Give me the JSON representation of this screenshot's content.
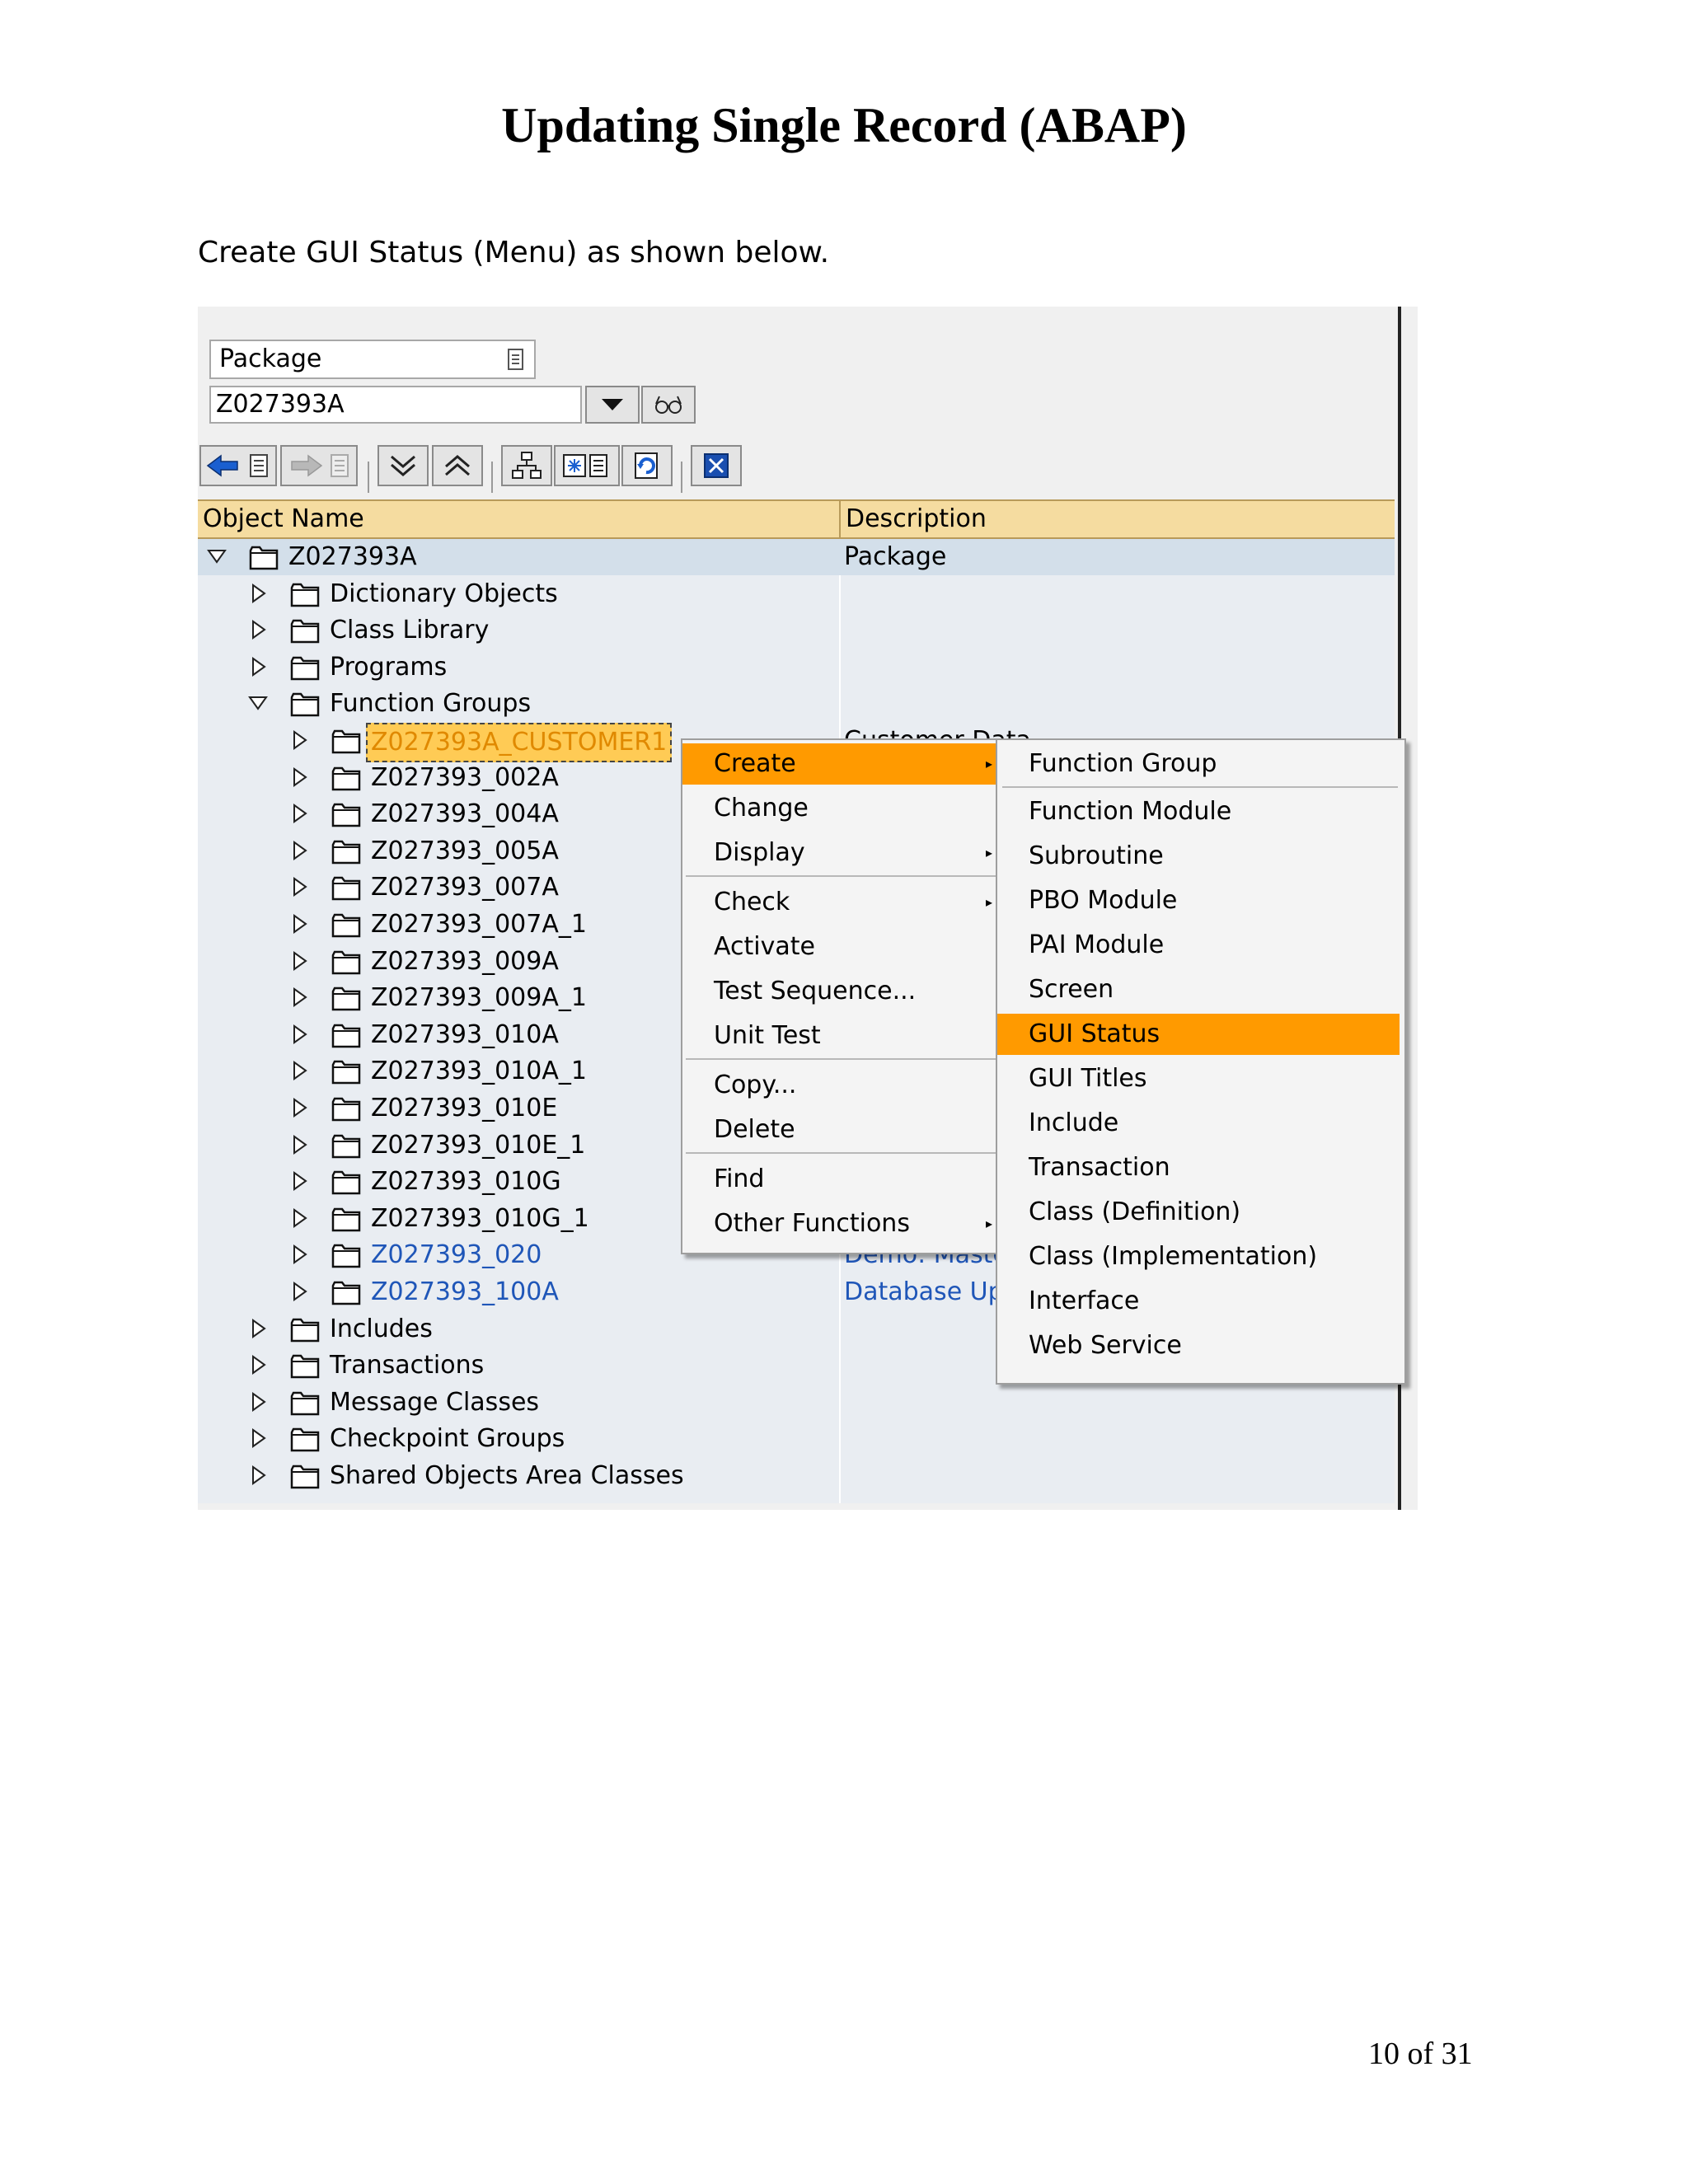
{
  "document": {
    "title": "Updating Single Record (ABAP)",
    "intro": "Create GUI Status (Menu) as shown below.",
    "page_number": "10 of 31"
  },
  "selector": {
    "type_label": "Package",
    "value": "Z027393A"
  },
  "tree": {
    "headers": {
      "name": "Object Name",
      "description": "Description"
    },
    "root": {
      "name": "Z027393A",
      "description": "Package"
    },
    "nodes_top": [
      "Dictionary Objects",
      "Class Library",
      "Programs",
      "Function Groups"
    ],
    "function_groups": [
      {
        "name": "Z027393A_CUSTOMER1",
        "description": "Customer Data"
      },
      {
        "name": "Z027393_002A",
        "description": ""
      },
      {
        "name": "Z027393_004A",
        "description": ""
      },
      {
        "name": "Z027393_005A",
        "description": ""
      },
      {
        "name": "Z027393_007A",
        "description": ""
      },
      {
        "name": "Z027393_007A_1",
        "description": ""
      },
      {
        "name": "Z027393_009A",
        "description": ""
      },
      {
        "name": "Z027393_009A_1",
        "description": ""
      },
      {
        "name": "Z027393_010A",
        "description": ""
      },
      {
        "name": "Z027393_010A_1",
        "description": ""
      },
      {
        "name": "Z027393_010E",
        "description": ""
      },
      {
        "name": "Z027393_010E_1",
        "description": ""
      },
      {
        "name": "Z027393_010G",
        "description": ""
      },
      {
        "name": "Z027393_010G_1",
        "description": ""
      },
      {
        "name": "Z027393_020",
        "description": "Demo: Maste"
      },
      {
        "name": "Z027393_100A",
        "description": "Database Up"
      }
    ],
    "nodes_bottom": [
      "Includes",
      "Transactions",
      "Message Classes",
      "Checkpoint Groups",
      "Shared Objects Area Classes"
    ]
  },
  "context_menu": [
    {
      "label": "Create",
      "submenu": true
    },
    {
      "label": "Change",
      "submenu": false
    },
    {
      "label": "Display",
      "submenu": true
    },
    {
      "label": "Check",
      "submenu": true
    },
    {
      "label": "Activate",
      "submenu": false
    },
    {
      "label": "Test Sequence...",
      "submenu": false
    },
    {
      "label": "Unit Test",
      "submenu": false
    },
    {
      "label": "Copy...",
      "submenu": false
    },
    {
      "label": "Delete",
      "submenu": false
    },
    {
      "label": "Find",
      "submenu": false
    },
    {
      "label": "Other Functions",
      "submenu": true
    }
  ],
  "submenu": [
    "Function Group",
    "Function Module",
    "Subroutine",
    "PBO Module",
    "PAI Module",
    "Screen",
    "GUI Status",
    "GUI Titles",
    "Include",
    "Transaction",
    "Class (Definition)",
    "Class (Implementation)",
    "Interface",
    "Web Service"
  ],
  "colors": {
    "highlight": "#ff9a00",
    "header_bg": "#f5dca0",
    "tree_bg": "#e9edf2",
    "link": "#1f56b8"
  }
}
